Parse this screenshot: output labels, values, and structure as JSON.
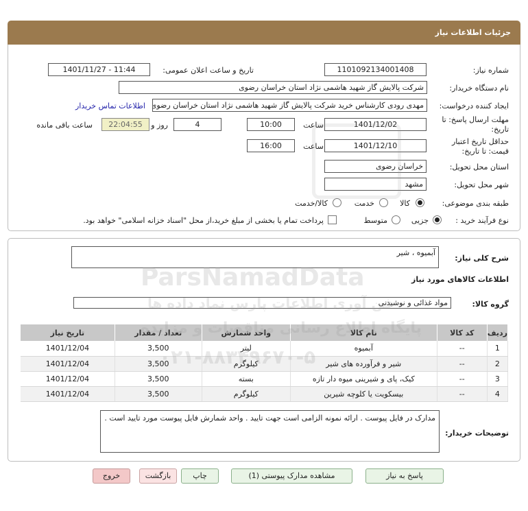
{
  "header": {
    "title": "جزئیات اطلاعات نیاز"
  },
  "info": {
    "need_number_label": "شماره نیاز:",
    "need_number": "1101092134001408",
    "announce_label": "تاریخ و ساعت اعلان عمومی:",
    "announce_value": "1401/11/27 - 11:44",
    "buyer_org_label": "نام دستگاه خریدار:",
    "buyer_org": "شرکت پالایش گاز شهید هاشمی نژاد   استان خراسان رضوی",
    "creator_label": "ایجاد کننده درخواست:",
    "creator": "مهدی رودی کارشناس خرید شرکت پالایش گاز شهید هاشمی نژاد   استان خراسان رضوی",
    "contact_link": "اطلاعات تماس خریدار",
    "reply_deadline_label_1": "مهلت ارسال پاسخ: تا",
    "reply_deadline_label_2": "تاریخ:",
    "reply_date": "1401/12/02",
    "time_label": "ساعت",
    "reply_time": "10:00",
    "days": "4",
    "days_label": "روز و",
    "remaining_time": "22:04:55",
    "remaining_label": "ساعت باقی مانده",
    "validity_label_1": "حداقل تاریخ اعتبار",
    "validity_label_2": "قیمت: تا تاریخ:",
    "validity_date": "1401/12/10",
    "validity_time": "16:00",
    "province_label": "استان محل تحویل:",
    "province": "خراسان رضوی",
    "city_label": "شهر محل تحویل:",
    "city": "مشهد",
    "category_label": "طبقه بندی موضوعی:",
    "category_options": [
      "کالا",
      "خدمت",
      "کالا/خدمت"
    ],
    "category_selected": "کالا",
    "process_label": "نوع فرآیند خرید :",
    "process_options": [
      "جزیی",
      "متوسط"
    ],
    "process_selected": "جزیی",
    "payment_note": "پرداخت تمام یا بخشی از مبلغ خرید،از محل \"اسناد خزانه اسلامی\" خواهد بود."
  },
  "description": {
    "label": "شرح کلی نیاز:",
    "value": "آبمیوه ، شیر",
    "goods_info_title": "اطلاعات کالاهای مورد نیاز",
    "group_label": "گروه کالا:",
    "group_value": "مواد غذائی و نوشیدنی"
  },
  "table": {
    "headers": [
      "ردیف",
      "کد کالا",
      "نام کالا",
      "واحد شمارش",
      "تعداد / مقدار",
      "تاریخ نیاز"
    ],
    "rows": [
      [
        "1",
        "--",
        "آبمیوه",
        "لیتر",
        "3,500",
        "1401/12/04"
      ],
      [
        "2",
        "--",
        "شیر و فرآورده های شیر",
        "کیلوگرم",
        "3,500",
        "1401/12/04"
      ],
      [
        "3",
        "--",
        "کیک، پای و شیرینی میوه دار تازه",
        "بسته",
        "3,500",
        "1401/12/04"
      ],
      [
        "4",
        "--",
        "بیسکویت یا کلوچه شیرین",
        "کیلوگرم",
        "3,500",
        "1401/12/04"
      ]
    ]
  },
  "buyer_notes": {
    "label": "توضیحات خریدار:",
    "value": "مدارک در فایل  پیوست . ارائه نمونه الزامی است جهت تایید . واحد شمارش فایل پیوست مورد تایید است ."
  },
  "buttons": {
    "reply": "پاسخ به نیاز",
    "attachments": "مشاهده مدارک پیوستی (1)",
    "print": "چاپ",
    "back": "بازگشت",
    "exit": "خروج"
  },
  "watermark": {
    "brand": "ParsNamadData",
    "line1": "پایگاه اطلاع رسانی مناقصات و مزایده",
    "line2": "فن آوری اطلاعات پارس نماد داده ها",
    "phone": "۰۲۱-۸۸۳۴۹۶۷۰-۵"
  },
  "colors": {
    "header_bg": "#9b7a4e",
    "button_green": "#e9f4e6",
    "remaining_bg": "#f1f0c6"
  }
}
